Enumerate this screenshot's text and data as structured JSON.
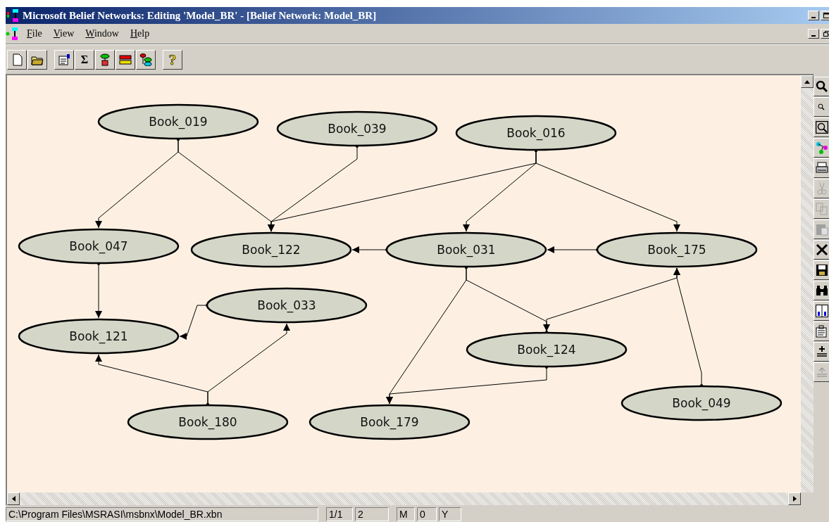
{
  "window": {
    "title": "Microsoft Belief Networks: Editing 'Model_BR' - [Belief Network:  Model_BR]"
  },
  "menu": [
    "File",
    "View",
    "Window",
    "Help"
  ],
  "toolbar": [
    [
      {
        "kind": "new"
      },
      {
        "kind": "open"
      }
    ],
    [
      {
        "kind": "properties"
      },
      {
        "kind": "sum",
        "label": "Σ"
      },
      {
        "kind": "node"
      },
      {
        "kind": "bars"
      },
      {
        "kind": "tree"
      }
    ],
    [
      {
        "kind": "help",
        "label": "?"
      }
    ]
  ],
  "network": {
    "nodes": [
      {
        "label": "Book_019"
      },
      {
        "label": "Book_039"
      },
      {
        "label": "Book_016"
      },
      {
        "label": "Book_047"
      },
      {
        "label": "Book_122"
      },
      {
        "label": "Book_031"
      },
      {
        "label": "Book_175"
      },
      {
        "label": "Book_033"
      },
      {
        "label": "Book_121"
      },
      {
        "label": "Book_124"
      },
      {
        "label": "Book_049"
      },
      {
        "label": "Book_180"
      },
      {
        "label": "Book_179"
      }
    ]
  },
  "side_toolbar": [
    {
      "kind": "zoom-in",
      "disabled": false
    },
    {
      "kind": "zoom-out",
      "disabled": false
    },
    {
      "kind": "zoom-fit",
      "disabled": false
    },
    {
      "kind": "network",
      "disabled": false
    },
    {
      "kind": "print",
      "disabled": false
    },
    {
      "kind": "cut",
      "disabled": true
    },
    {
      "kind": "copy",
      "disabled": true
    },
    {
      "kind": "paste",
      "disabled": true
    },
    {
      "kind": "delete",
      "disabled": false
    },
    {
      "kind": "save",
      "disabled": false
    },
    {
      "kind": "find",
      "disabled": false
    },
    {
      "kind": "layout",
      "disabled": false
    },
    {
      "kind": "properties",
      "disabled": false
    },
    {
      "kind": "move-down",
      "disabled": false
    },
    {
      "kind": "move-up",
      "disabled": true
    }
  ],
  "status_bar": {
    "path": "C:\\Program Files\\MSRASI\\msbnx\\Model_BR.xbn",
    "panes": [
      "1/1",
      "2",
      "M",
      "0",
      "Y"
    ]
  }
}
